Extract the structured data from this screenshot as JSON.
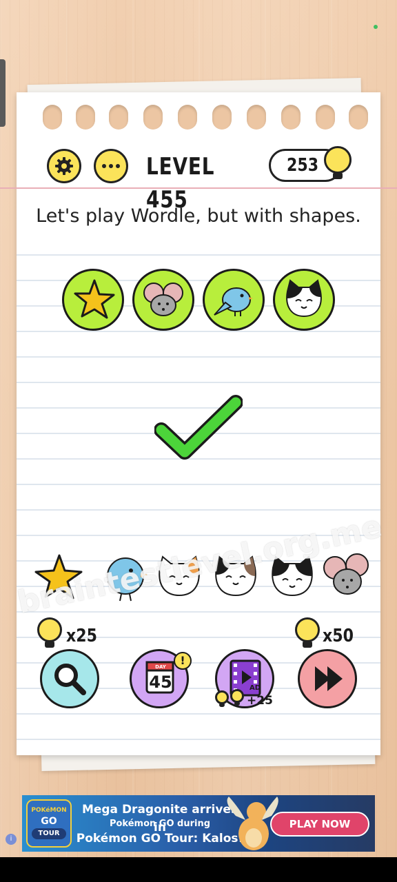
{
  "header": {
    "level_title": "LEVEL 455",
    "hint_count": "253",
    "settings_icon": "gear-icon",
    "more_icon": "more-dots-icon"
  },
  "question": "Let's play Wordle, but with shapes.",
  "answer_slots": [
    "star",
    "mouse",
    "bird",
    "cat"
  ],
  "result": "correct-checkmark",
  "watermark": "braintestlevel.org.me",
  "tray_items": [
    "star",
    "bird",
    "calico-cat",
    "calico-cat",
    "black-white-cat",
    "mouse"
  ],
  "tools": {
    "search_cost": "x25",
    "skip_cost": "x50",
    "calendar_day_label": "DAY",
    "calendar_number": "45",
    "calendar_badge": "!",
    "video_ad_label": "AD",
    "video_reward": "+25"
  },
  "ad": {
    "logo_top": "POKéMON",
    "logo_go": "GO",
    "logo_tour": "TOUR",
    "line1": "Mega Dragonite arrives in",
    "line2": "Pokémon GO during",
    "line3": "Pokémon GO Tour: Kalos!",
    "cta": "PLAY NOW",
    "info_icon": "i"
  },
  "colors": {
    "slot_green": "#b8ee3c",
    "hint_yellow": "#fbe35a",
    "check_green": "#4cd43a",
    "search_teal": "#a6e7ea",
    "calendar_purple": "#d2a6f4",
    "skip_pink": "#f4a0a4"
  }
}
